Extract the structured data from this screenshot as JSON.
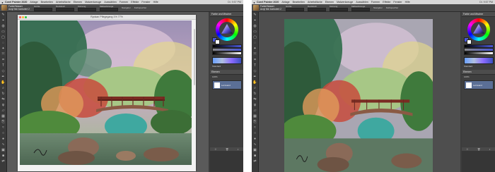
{
  "menubar": {
    "app": "Corel Painter 2020",
    "items": [
      "Ablage",
      "Bearbeiten",
      "Arbeitsfläche",
      "Ebenen",
      "Malwerkzeuge",
      "Auswählen",
      "Formen",
      "Effekte",
      "Fenster",
      "Hilfe"
    ],
    "status": "Di. 9:57 PM"
  },
  "propbar": {
    "brush_category": "Farbe/Wasser",
    "brush_variant": "Acryl fein konturiert 2",
    "props": [
      "Größe",
      "Deckkraft",
      "Körnung",
      "Malwerkzeuge",
      "Navigator",
      "Farbspeicher"
    ]
  },
  "document": {
    "title": "Ryokan Pflegegang 1% 77%"
  },
  "panel": {
    "title": "Farbe und Mischer",
    "layers_title": "Ebenen",
    "layer_name": "Leinwand",
    "mix_label": "Standard",
    "composite": "100%"
  },
  "icons": {
    "tools": [
      "brush-icon",
      "dropper-icon",
      "fill-icon",
      "eraser-icon",
      "select-rect-icon",
      "lasso-icon",
      "wand-icon",
      "transform-icon",
      "crop-icon",
      "text-icon",
      "shape-icon",
      "pen-icon",
      "grabber-icon",
      "zoom-icon",
      "rotate-icon",
      "mirror-icon",
      "divine-proportion-icon",
      "perspective-icon",
      "layout-grid-icon",
      "clone-icon",
      "blend-icon",
      "dodge-icon",
      "burn-icon",
      "liquify-icon",
      "stamp-icon",
      "color-icon",
      "swap-icon"
    ]
  },
  "colors": {
    "primary": "#4a58d8",
    "secondary": "#ffffff"
  }
}
